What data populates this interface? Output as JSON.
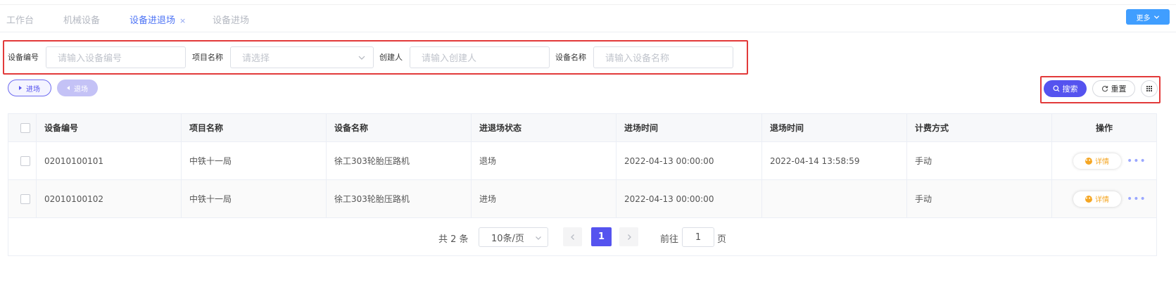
{
  "tabs": [
    {
      "label": "工作台"
    },
    {
      "label": "机械设备"
    },
    {
      "label": "设备进退场",
      "close": "×"
    },
    {
      "label": "设备进场"
    }
  ],
  "more_button": "更多",
  "form": {
    "fields": [
      {
        "label": "设备编号",
        "placeholder": "请输入设备编号"
      },
      {
        "label": "项目名称",
        "placeholder": "请选择"
      },
      {
        "label": "创建人",
        "placeholder": "请输入创建人"
      },
      {
        "label": "设备名称",
        "placeholder": "请输入设备名称"
      }
    ]
  },
  "actions": {
    "enter": "进场",
    "exit": "退场"
  },
  "toolbar": {
    "search": "搜索",
    "reset": "重置"
  },
  "table": {
    "columns": [
      "设备编号",
      "项目名称",
      "设备名称",
      "进退场状态",
      "进场时间",
      "退场时间",
      "计费方式",
      "操作"
    ],
    "rows": [
      {
        "code": "02010100101",
        "project": "中铁十一局",
        "name": "徐工303轮胎压路机",
        "status": "退场",
        "enter_time": "2022-04-13 00:00:00",
        "exit_time": "2022-04-14 13:58:59",
        "billing": "手动",
        "action": "详情"
      },
      {
        "code": "02010100102",
        "project": "中铁十一局",
        "name": "徐工303轮胎压路机",
        "status": "进场",
        "enter_time": "2022-04-13 00:00:00",
        "exit_time": "",
        "billing": "手动",
        "action": "详情"
      }
    ]
  },
  "pagination": {
    "total": "共 2 条",
    "page_size": "10条/页",
    "current_page": "1",
    "goto_label": "前往",
    "goto_value": "1",
    "page_suffix": "页"
  },
  "colors": {
    "primary": "#5553ef",
    "tab_active": "#4e74f5",
    "highlight_box": "#e23a3a",
    "detail": "#f5a623"
  }
}
